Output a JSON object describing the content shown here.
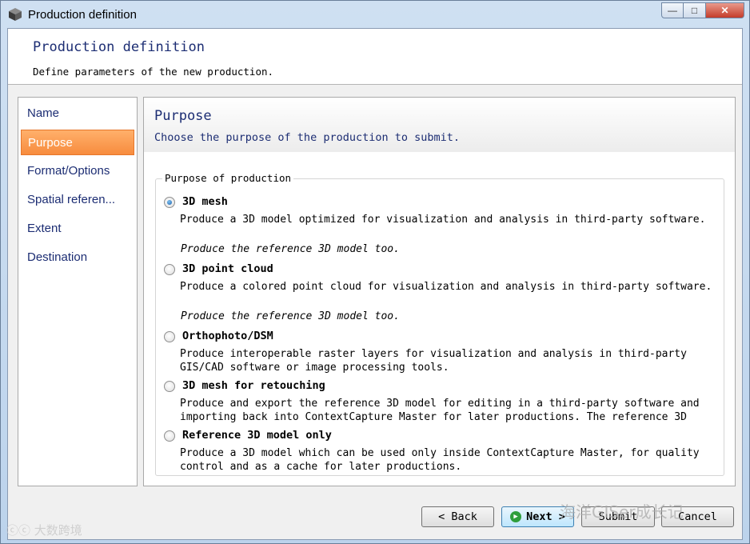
{
  "window": {
    "title": "Production definition",
    "controls": {
      "minimize": "—",
      "maximize": "□",
      "close": "✕"
    }
  },
  "header": {
    "title": "Production definition",
    "subtitle": "Define parameters of the new production."
  },
  "nav": {
    "items": [
      {
        "label": "Name"
      },
      {
        "label": "Purpose",
        "active": true
      },
      {
        "label": "Format/Options"
      },
      {
        "label": "Spatial referen..."
      },
      {
        "label": "Extent"
      },
      {
        "label": "Destination"
      }
    ]
  },
  "panel": {
    "title": "Purpose",
    "subtitle": "Choose the purpose of the production to submit.",
    "group_label": "Purpose of production",
    "options": [
      {
        "label": "3D mesh",
        "description": "Produce a 3D model optimized for visualization and analysis in third-party software.",
        "extra": "Produce the reference 3D model too.",
        "selected": true
      },
      {
        "label": "3D point cloud",
        "description": "Produce a colored point cloud for visualization and analysis in third-party software.",
        "extra": "Produce the reference 3D model too.",
        "selected": false
      },
      {
        "label": "Orthophoto/DSM",
        "description": "Produce interoperable raster layers for visualization and analysis in third-party GIS/CAD software or image processing tools.",
        "selected": false
      },
      {
        "label": "3D mesh for retouching",
        "description": "Produce and export the reference 3D model for editing in a third-party software and importing back into ContextCapture Master for later productions. The reference 3D",
        "selected": false
      },
      {
        "label": "Reference 3D model only",
        "description": "Produce a 3D model which can be used only inside ContextCapture Master, for quality control and as a cache for later productions.",
        "selected": false
      }
    ]
  },
  "buttons": {
    "back": "< Back",
    "next": "Next >",
    "submit": "Submit",
    "cancel": "Cancel"
  },
  "watermarks": {
    "left": "ⓒⓒ 大数跨境",
    "right": "海洋GISer成长记"
  },
  "colors": {
    "accent_orange": "#f78c3e",
    "title_blue": "#1c2d73",
    "window_frame": "#bcd3ec"
  }
}
